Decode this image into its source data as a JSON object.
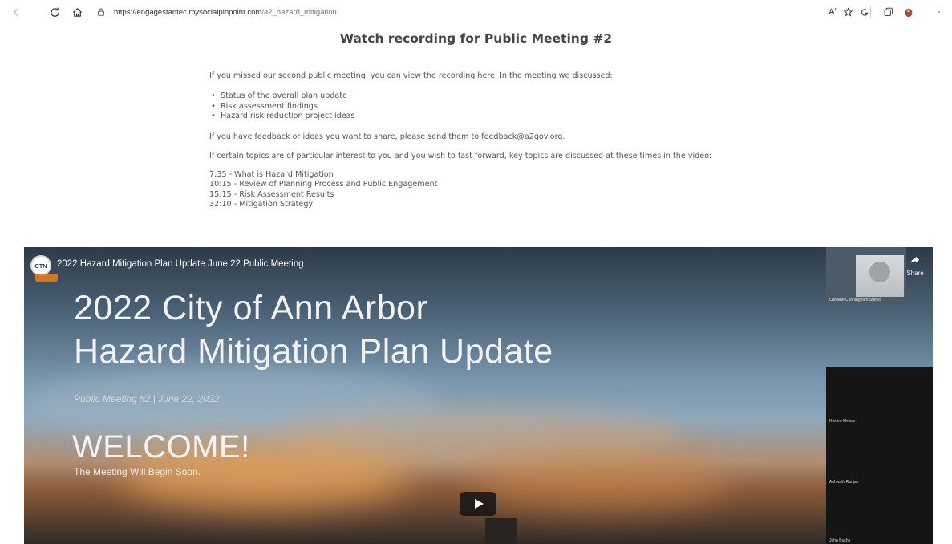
{
  "browser": {
    "url_host": "https://engagestantec.mysocialpinpoint.com",
    "url_path": "/a2_hazard_mitigation",
    "read_aloud_label": "Aʹ"
  },
  "page": {
    "heading": "Watch recording for Public Meeting #2",
    "intro": "If you missed our second public meeting, you can view the recording here. In the meeting we discussed:",
    "bullets": [
      "Status of the overall plan update",
      "Risk assessment findings",
      "Hazard risk reduction project ideas"
    ],
    "feedback": "If you have feedback or ideas you want to share, please send them to feedback@a2gov.org.",
    "topics_intro": "If certain topics are of particular interest to you and you wish to fast forward, key topics are discussed at these times in the video:",
    "times": [
      "7:35 - What is Hazard Mitigation",
      "10:15 - Review of Planning Process and Public Engagement",
      "15:15 - Risk Assessment Results",
      "32:10 - Mitigation Strategy"
    ]
  },
  "video": {
    "channel_logo": "CTN",
    "title": "2022 Hazard Mitigation Plan Update June 22 Public Meeting",
    "share_label": "Share",
    "slide": {
      "line1": "2022 City of Ann Arbor",
      "line2": "Hazard Mitigation Plan Update",
      "subtitle": "Public Meeting #2   |   June 22, 2022",
      "welcome": "WELCOME!",
      "begin": "The Meeting Will Begin Soon."
    },
    "participants": [
      "Caroline Cunningham Stanko",
      "Kristen Means",
      "Ashwath Ranjan",
      "John Buche"
    ]
  }
}
